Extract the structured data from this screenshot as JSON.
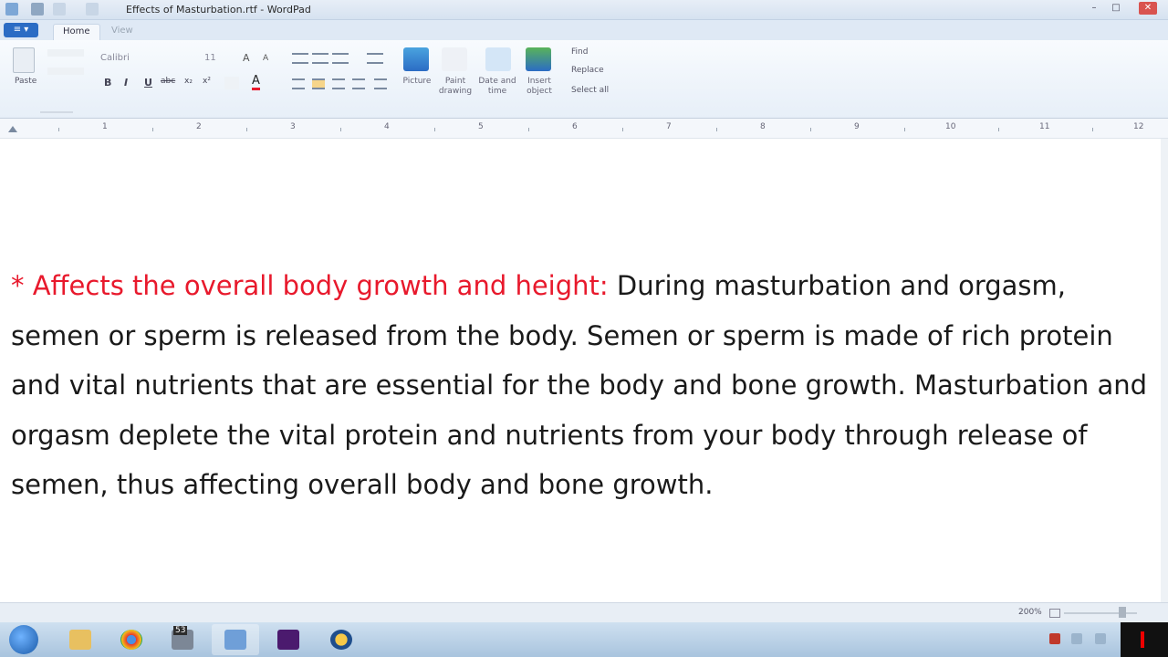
{
  "window": {
    "title": "Effects of Masturbation.rtf - WordPad",
    "controls": {
      "minimize": "–",
      "maximize": "□",
      "close": "✕"
    }
  },
  "ribbon": {
    "app_menu": "≡ ▾",
    "tabs": [
      {
        "label": "Home",
        "active": true
      },
      {
        "label": "View",
        "active": false
      }
    ],
    "clipboard": {
      "paste_label": "Paste"
    },
    "font": {
      "family": "Calibri",
      "size": "11"
    },
    "format_buttons": [
      "B",
      "I",
      "U",
      "abc",
      "x₂",
      "x²"
    ],
    "insert": {
      "picture": "Picture",
      "paint": "Paint drawing",
      "datetime": "Date and time",
      "object": "Insert object"
    },
    "editing": {
      "find": "Find",
      "replace": "Replace",
      "select_all": "Select all"
    }
  },
  "ruler": {
    "numbers": [
      "1",
      "2",
      "3",
      "4",
      "5",
      "6",
      "7",
      "8",
      "9",
      "10",
      "11",
      "12"
    ]
  },
  "document": {
    "bullet": "* ",
    "heading": "Affects the overall body growth and height:",
    "body": " During masturbation and orgasm, semen or sperm is released from the body. Semen or sperm is made of rich protein and vital nutrients that are essential for the body and bone growth. Masturbation and orgasm deplete the vital protein and nutrients from your body through release of semen, thus affecting overall body and bone growth."
  },
  "status_bar": {
    "zoom": "200%"
  },
  "taskbar": {
    "badge": "53",
    "items": [
      "windows-explorer",
      "chrome",
      "app-3",
      "wordpad",
      "premiere",
      "media-player"
    ]
  },
  "colors": {
    "heading": "#e8192c",
    "body_text": "#1a1a1a",
    "accent": "#2b6cc4"
  }
}
